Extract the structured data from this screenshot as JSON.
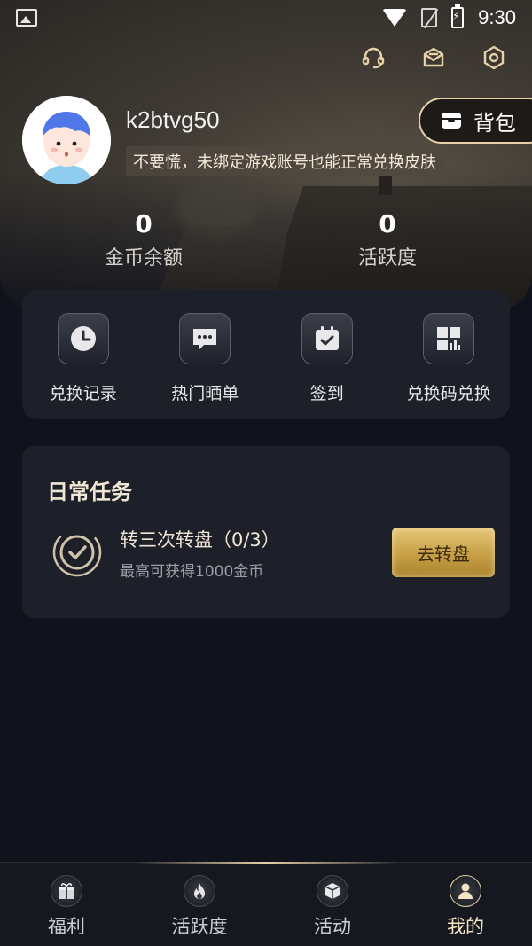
{
  "status_bar": {
    "time": "9:30"
  },
  "profile": {
    "username": "k2btvg50",
    "notice": "不要慌，未绑定游戏账号也能正常兑换皮肤",
    "backpack_label": "背包"
  },
  "stats": [
    {
      "value": "0",
      "label": "金币余额"
    },
    {
      "value": "0",
      "label": "活跃度"
    }
  ],
  "shortcuts": [
    {
      "label": "兑换记录",
      "icon": "clock-icon"
    },
    {
      "label": "热门晒单",
      "icon": "chat-bubble-icon"
    },
    {
      "label": "签到",
      "icon": "calendar-check-icon"
    },
    {
      "label": "兑换码兑换",
      "icon": "grid-code-icon"
    }
  ],
  "daily_tasks": {
    "title": "日常任务",
    "items": [
      {
        "name": "转三次转盘（0/3）",
        "subtitle": "最高可获得1000金币",
        "button": "去转盘"
      }
    ]
  },
  "bottom_nav": [
    {
      "label": "福利",
      "icon": "gift-icon",
      "active": false
    },
    {
      "label": "活跃度",
      "icon": "flame-icon",
      "active": false
    },
    {
      "label": "活动",
      "icon": "cube-icon",
      "active": false
    },
    {
      "label": "我的",
      "icon": "user-icon",
      "active": true
    }
  ],
  "colors": {
    "accent_gold": "#e7d2a8",
    "background": "#11131c",
    "card": "#1d2029"
  }
}
